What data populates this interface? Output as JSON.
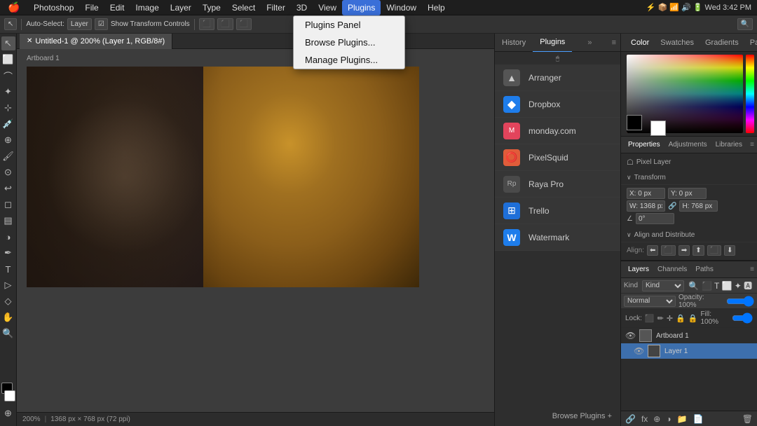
{
  "menubar": {
    "apple": "🍎",
    "items": [
      "Photoshop",
      "File",
      "Edit",
      "Image",
      "Layer",
      "Type",
      "Select",
      "Filter",
      "3D",
      "View",
      "Plugins",
      "Window",
      "Help"
    ],
    "active_item": "Plugins",
    "right": "Wed 3:42 PM 100%"
  },
  "plugins_menu": {
    "items": [
      "Plugins Panel",
      "Browse Plugins...",
      "Manage Plugins..."
    ]
  },
  "toolbar": {
    "auto_select_label": "Auto-Select:",
    "layer_label": "Layer",
    "transform_label": "Show Transform Controls"
  },
  "tab": {
    "title": "Untitled-1 @ 200% (Layer 1, RGB/8#)"
  },
  "artboard": {
    "label": "Artboard 1"
  },
  "status": {
    "zoom": "200%",
    "dimensions": "1368 px × 768 px (72 ppi)"
  },
  "plugins_panel": {
    "tabs": [
      "History",
      "Plugins"
    ],
    "active_tab": "Plugins",
    "plugins": [
      {
        "name": "Arranger",
        "icon": "▲",
        "color": "#6a6a6a"
      },
      {
        "name": "Dropbox",
        "icon": "◆",
        "color": "#1e7deb"
      },
      {
        "name": "monday.com",
        "icon": "⬛",
        "color": "#e2445c"
      },
      {
        "name": "PixelSquid",
        "icon": "⭕",
        "color": "#e05c3a"
      },
      {
        "name": "Raya Pro",
        "icon": "Rp",
        "color": "#5a5a5a"
      },
      {
        "name": "Trello",
        "icon": "⊞",
        "color": "#1e6fd9"
      },
      {
        "name": "Watermark",
        "icon": "W",
        "color": "#1e7deb"
      }
    ],
    "browse_label": "Browse Plugins +"
  },
  "color_panel": {
    "tabs": [
      "Color",
      "Swatches",
      "Gradients",
      "Patterns"
    ],
    "active_tab": "Color"
  },
  "properties_panel": {
    "tabs": [
      "Properties",
      "Adjustments",
      "Libraries"
    ],
    "active_tab": "Properties",
    "layer_label": "Pixel Layer",
    "transform_label": "Transform",
    "align_label": "Align and Distribute",
    "align_sub": "Align:"
  },
  "layers_panel": {
    "tabs": [
      "Layers",
      "Channels",
      "Paths"
    ],
    "active_tab": "Layers",
    "kind_label": "Kind",
    "normal_label": "Normal",
    "opacity_label": "Opacity: 100%",
    "lock_label": "Lock:",
    "fill_label": "Fill: 100%",
    "layers": [
      {
        "name": "Artboard 1",
        "type": "artboard",
        "visible": true
      },
      {
        "name": "Layer 1",
        "type": "layer",
        "visible": true,
        "active": true
      }
    ]
  }
}
